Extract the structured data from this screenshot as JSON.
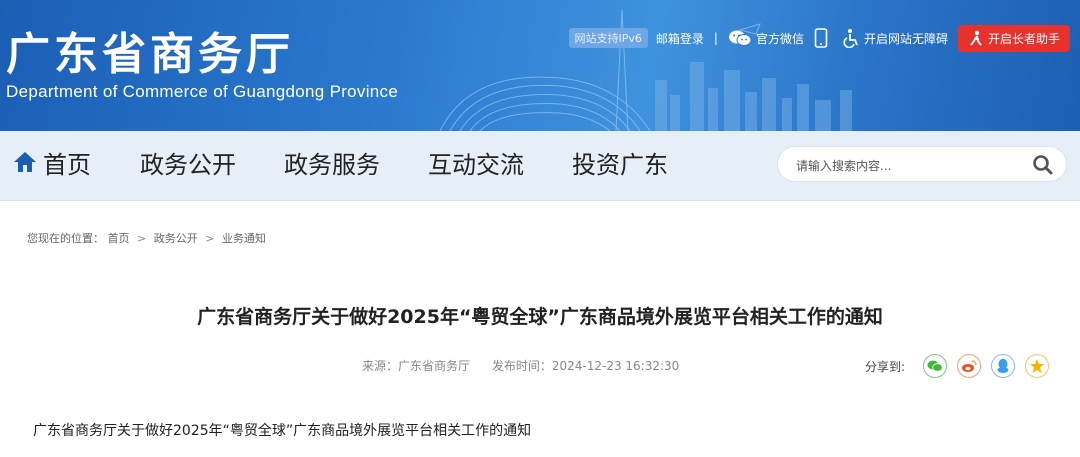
{
  "header": {
    "title": "广东省商务厅",
    "subtitle": "Department of Commerce of Guangdong Province",
    "ipv6_badge": "网站支持IPv6",
    "links": {
      "mail_login": "邮箱登录",
      "separator": "|",
      "wechat": "官方微信",
      "accessibility": "开启网站无障碍",
      "elder_mode": "开启长者助手"
    },
    "colors": {
      "banner": "#2a78cf",
      "elder_button": "#e7312d"
    }
  },
  "nav": {
    "items": [
      "首页",
      "政务公开",
      "政务服务",
      "互动交流",
      "投资广东"
    ],
    "search_placeholder": "请输入搜索内容..."
  },
  "breadcrumb": {
    "prefix": "您现在的位置：",
    "items": [
      "首页",
      "政务公开",
      "业务通知"
    ],
    "separator": ">"
  },
  "article": {
    "title": "广东省商务厅关于做好2025年“粤贸全球”广东商品境外展览平台相关工作的通知",
    "source": "来源：广东省商务厅",
    "published": "发布时间：2024-12-23 16:32:30",
    "share_label": "分享到:",
    "share_icons": [
      "wechat-icon",
      "weibo-icon",
      "qq-icon",
      "qzone-icon"
    ],
    "body_first_line": "广东省商务厅关于做好2025年“粤贸全球”广东商品境外展览平台相关工作的通知"
  }
}
